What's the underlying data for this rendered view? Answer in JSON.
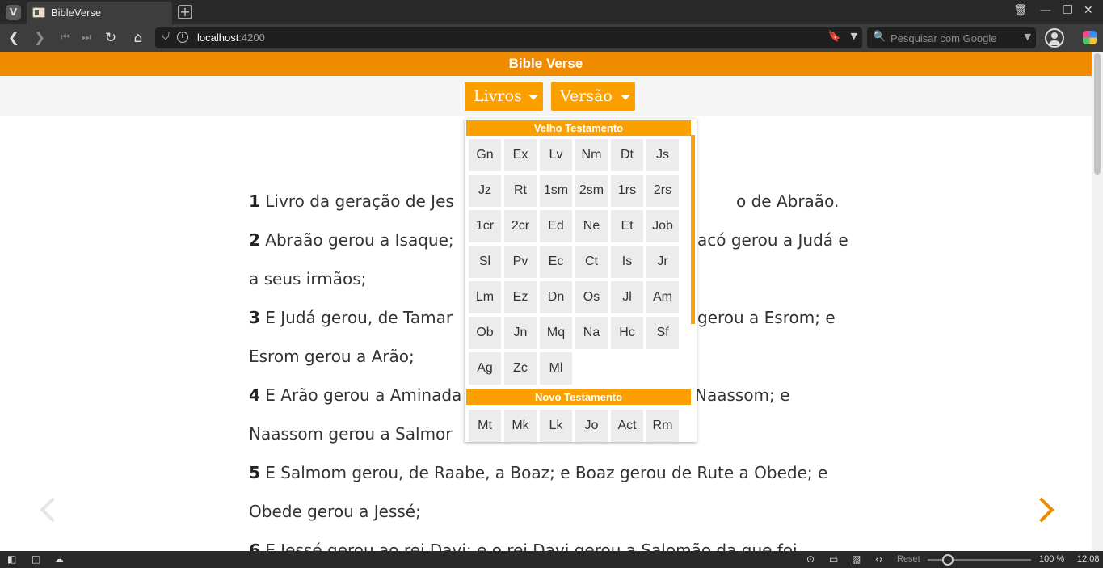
{
  "browser": {
    "tab_title": "BibleVerse",
    "new_tab_glyph": "+",
    "url_host": "localhost",
    "url_port": ":4200",
    "search_placeholder": "Pesquisar com Google",
    "icons": [
      "vivaldi-logo-icon",
      "back-icon",
      "forward-icon",
      "rewind-icon",
      "fast-forward-icon",
      "reload-icon",
      "home-icon",
      "shield-icon",
      "info-icon",
      "bookmark-icon",
      "search-icon",
      "profile-icon",
      "extension-icon",
      "trash-icon",
      "minimize-icon",
      "restore-icon",
      "close-icon"
    ]
  },
  "app": {
    "title": "Bible Verse",
    "livros_label": "Livros",
    "versao_label": "Versão",
    "accent_color": "#f08b00",
    "button_color": "#fba000"
  },
  "books_menu": {
    "old_header": "Velho Testamento",
    "old_books": [
      "Gn",
      "Ex",
      "Lv",
      "Nm",
      "Dt",
      "Js",
      "Jz",
      "Rt",
      "1sm",
      "2sm",
      "1rs",
      "2rs",
      "1cr",
      "2cr",
      "Ed",
      "Ne",
      "Et",
      "Job",
      "Sl",
      "Pv",
      "Ec",
      "Ct",
      "Is",
      "Jr",
      "Lm",
      "Ez",
      "Dn",
      "Os",
      "Jl",
      "Am",
      "Ob",
      "Jn",
      "Mq",
      "Na",
      "Hc",
      "Sf",
      "Ag",
      "Zc",
      "Ml"
    ],
    "new_header": "Novo Testamento",
    "new_books": [
      "Mt",
      "Mk",
      "Lk",
      "Jo",
      "Act",
      "Rm"
    ]
  },
  "verses": [
    {
      "num": "1",
      "text_a": "Livro da geração de Jes",
      "text_b": "o de Abraão."
    },
    {
      "num": "2",
      "text_a": "Abraão gerou a Isaque;",
      "text_b": "acó gerou a Judá e",
      "text_c": "a seus irmãos;"
    },
    {
      "num": "3",
      "text_a": "E Judá gerou, de Tamar",
      "text_b": "gerou a Esrom; e",
      "text_c": "Esrom gerou a Arão;"
    },
    {
      "num": "4",
      "text_a": "E Arão gerou a Aminada",
      "text_b": "Naassom; e",
      "text_c": "Naassom gerou a Salmor"
    },
    {
      "num": "5",
      "text_a": "E Salmom gerou, de Raabe, a Boaz; e Boaz gerou de Rute a Obede; e",
      "text_c": "Obede gerou a Jessé;"
    },
    {
      "num": "6",
      "text_a": "E Jessé gerou ao rei Davi; e o rei Davi gerou a Salomão da que foi"
    }
  ],
  "status": {
    "reset_label": "Reset",
    "zoom_label": "100 %",
    "clock": "12:08",
    "zoom_level_percent": 100
  }
}
